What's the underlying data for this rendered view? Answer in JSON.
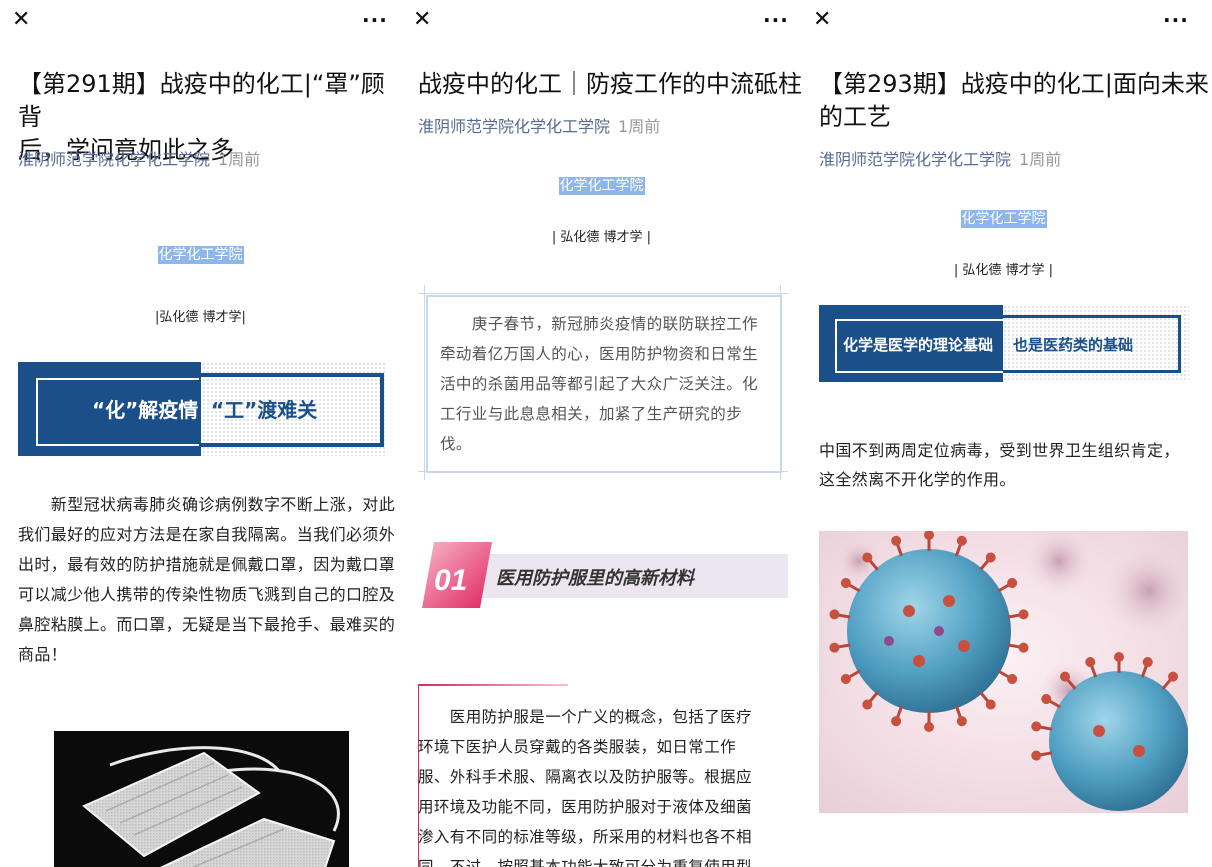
{
  "common": {
    "close_icon": "✕",
    "more_icon": "···"
  },
  "panel1": {
    "title_line1": "【第291期】战疫中的化工|“罩”顾背",
    "title_line2": "后，学问竟如此之多",
    "source": "淮阴师范学院化学化工学院",
    "time": "1周前",
    "college": "化学化工学院",
    "motto": "|弘化德 博才学|",
    "banner_left": "“化”解疫情",
    "banner_right": "“工”渡难关",
    "para": [
      "　　新型冠状病毒肺炎确诊病例数字不断上涨，对此",
      "我们最好的应对方法是在家自我隔离。当我们必须外",
      "出时，最有效的防护措施就是佩戴口罩，因为戴口罩",
      "可以减少他人携带的传染性物质飞溅到自己的口腔及",
      "鼻腔粘膜上。而口罩，无疑是当下最抢手、最难买的",
      "商品！"
    ]
  },
  "panel2": {
    "title": "战疫中的化工｜防疫工作的中流砥柱",
    "source": "淮阴师范学院化学化工学院",
    "time": "1周前",
    "college": "化学化工学院",
    "motto": "| 弘化德 博才学 |",
    "box": [
      "　　庚子春节，新冠肺炎疫情的联防联控工作",
      "牵动着亿万国人的心，医用防护物资和日常生",
      "活中的杀菌用品等都引起了大众广泛关注。化",
      "工行业与此息息相关，加紧了生产研究的步",
      "伐。"
    ],
    "section_num": "01",
    "section_title": "医用防护服里的高新材料",
    "para": [
      "　　医用防护服是一个广义的概念，包括了医疗",
      "环境下医护人员穿戴的各类服装，如日常工作",
      "服、外科手术服、隔离衣以及防护服等。根据应",
      "用环境及功能不同，医用防护服对于液体及细菌",
      "渗入有不同的标准等级，所采用的材料也各不相",
      "同。不过，按照基本功能大致可分为重复使用型"
    ]
  },
  "panel3": {
    "title_line1": "【第293期】战疫中的化工|面向未来",
    "title_line2": "的工艺",
    "source": "淮阴师范学院化学化工学院",
    "time": "1周前",
    "college": "化学化工学院",
    "motto": "| 弘化德 博才学 |",
    "banner_left": "化学是医学的理论基础",
    "banner_right": "也是医药类的基础",
    "para": [
      "中国不到两周定位病毒，受到世界卫生组织肯定，",
      "这全然离不开化学的作用。"
    ]
  },
  "colors": {
    "navy": "#1b4f8a",
    "link": "#576b95",
    "highlight": "#8fb6e8",
    "pink": "#e0245e",
    "lavender": "#ebe6ef"
  }
}
